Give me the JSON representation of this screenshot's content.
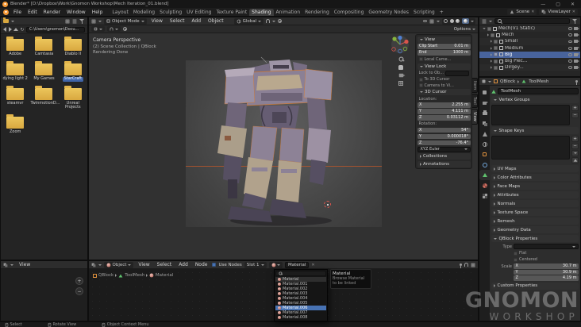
{
  "window": {
    "title": "Blender*  [D:\\Dropbox\\Work\\Gnomon Workshop\\Mech Iteration_01.blend]",
    "minimize": "—",
    "maximize": "▢",
    "close": "✕"
  },
  "glyphs": {
    "plus": "+",
    "minus": "−",
    "x": "✕",
    "refresh": "↻"
  },
  "axes": {
    "x": "X",
    "y": "Y",
    "z": "Z"
  },
  "menubar": {
    "menus": [
      "File",
      "Edit",
      "Render",
      "Window",
      "Help"
    ],
    "workspaces": [
      "Layout",
      "Modeling",
      "Sculpting",
      "UV Editing",
      "Texture Paint",
      "Shading",
      "Animation",
      "Rendering",
      "Compositing",
      "Geometry Nodes",
      "Scripting"
    ],
    "active_workspace": "Shading",
    "new_workspace": "+",
    "scene_name": "Scene",
    "view_layer_name": "ViewLayer"
  },
  "viewport": {
    "header": {
      "mode": "Object Mode",
      "view": "View",
      "select": "Select",
      "add": "Add",
      "object": "Object",
      "orientation": "Global",
      "options": "Options"
    },
    "overlay": {
      "line1": "Camera Perspective",
      "line2": "(2) Scene Collection | QBlock",
      "line3": "Rendering Done"
    },
    "sidebar_tabs": {
      "item": "Item",
      "tool": "Tool",
      "view": "View"
    }
  },
  "file_browser": {
    "path": "C:\\Users\\gnomon\\Docu...",
    "folders": [
      "Adobe",
      "Camtasia",
      "Diablo II",
      "dying light 2",
      "My Games",
      "StarCraft",
      "steamvr",
      "TwinmotionD...",
      "Unreal Projects",
      "Zoom"
    ]
  },
  "n_panel": {
    "view_title": "View",
    "clip_start_label": "Clip Start",
    "clip_start": "0.01 m",
    "clip_end_label": "End",
    "clip_end": "1000 m",
    "local_camera_label": "Local Came...",
    "view_lock_title": "View Lock",
    "lock_object_label": "Lock to Ob...",
    "to_3d_cursor_label": "To 3D Cursor",
    "camera_to_view_label": "Camera to Vi...",
    "cursor_title": "3D Cursor",
    "location_label": "Location:",
    "loc_x": "2.255 m",
    "loc_y": "4.111 m",
    "loc_z": "0.03112 m",
    "rotation_label": "Rotation:",
    "rot_x": "54°",
    "rot_y": "0.000018°",
    "rot_z": "-76.4°",
    "rotation_order": "XYZ Euler",
    "collections_title": "Collections",
    "annotations_title": "Annotations"
  },
  "outliner": {
    "rows": [
      {
        "label": "Mech(V1 Static)"
      },
      {
        "label": "Mech"
      },
      {
        "label": "Small"
      },
      {
        "label": "Medium"
      },
      {
        "label": "Big"
      },
      {
        "label": "Big Piec..."
      },
      {
        "label": "Dirgey..."
      }
    ]
  },
  "properties": {
    "breadcrumb_object": "QBlock",
    "breadcrumb_data": "ToolMesh",
    "name_value": "ToolMesh",
    "vertex_groups_title": "Vertex Groups",
    "shape_keys_title": "Shape Keys",
    "collapsed": [
      "UV Maps",
      "Color Attributes",
      "Face Maps",
      "Attributes",
      "Normals",
      "Texture Space",
      "Remesh",
      "Geometry Data"
    ],
    "qblock_title": "QBlock Properties",
    "type_label": "Type",
    "flat_label": "Flat",
    "centered_label": "Centered",
    "scale_label": "Scale",
    "scale_x": "30.7 m",
    "scale_y": "30.9 m",
    "scale_z": "4.19 m",
    "custom_title": "Custom Properties"
  },
  "shader": {
    "shader_type": "Object",
    "view": "View",
    "select": "Select",
    "add": "Add",
    "node": "Node",
    "use_nodes": "Use Nodes",
    "slot": "Slot 1",
    "material_name": "Material",
    "crumb_object": "QBlock",
    "crumb_data": "ToolMesh",
    "crumb_material": "Material",
    "dropdown_items": [
      "Material",
      "Material.001",
      "Material.002",
      "Material.003",
      "Material.004",
      "Material.005",
      "Material.006",
      "Material.007",
      "Material.008"
    ],
    "tooltip_title": "Material",
    "tooltip_line": "Browse Material to be linked"
  },
  "image_editor": {
    "view": "View"
  },
  "statusbar": {
    "select": "Select",
    "rotate": "Rotate View",
    "context": "Object Context Menu"
  },
  "watermark": {
    "line1": "GNOMON",
    "line2": "WORKSHOP"
  }
}
